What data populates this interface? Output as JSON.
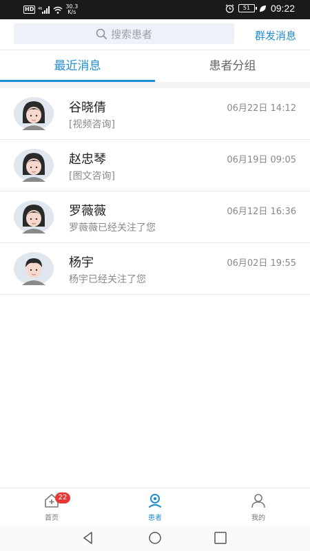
{
  "status_bar": {
    "network_badge": "HD",
    "signal": "46",
    "speed": "30.3",
    "speed_unit": "K/s",
    "battery": "51",
    "time": "09:22"
  },
  "header": {
    "search_placeholder": "搜索患者",
    "group_message_label": "群发消息"
  },
  "tabs": [
    {
      "label": "最近消息",
      "active": true
    },
    {
      "label": "患者分组",
      "active": false
    }
  ],
  "conversations": [
    {
      "name": "谷晓倩",
      "time": "06月22日 14:12",
      "preview": "[视频咨询]",
      "avatar": "female-avatar"
    },
    {
      "name": "赵忠琴",
      "time": "06月19日 09:05",
      "preview": "[图文咨询]",
      "avatar": "female-avatar"
    },
    {
      "name": "罗薇薇",
      "time": "06月12日 16:36",
      "preview": "罗薇薇已经关注了您",
      "avatar": "female-avatar"
    },
    {
      "name": "杨宇",
      "time": "06月02日 19:55",
      "preview": "杨宇已经关注了您",
      "avatar": "male-avatar"
    }
  ],
  "bottom_nav": [
    {
      "label": "首页",
      "icon": "home-plus-icon",
      "badge": "22",
      "active": false
    },
    {
      "label": "患者",
      "icon": "patient-icon",
      "active": true
    },
    {
      "label": "我的",
      "icon": "person-icon",
      "active": false
    }
  ],
  "colors": {
    "accent": "#1f8cd1",
    "badge": "#e53935"
  }
}
